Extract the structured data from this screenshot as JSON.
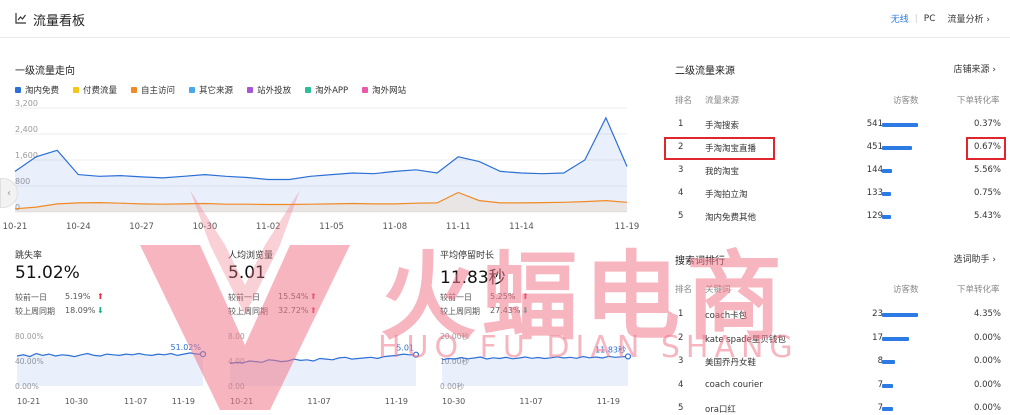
{
  "header": {
    "title": "流量看板",
    "options": [
      "无线",
      "PC",
      "流量分析"
    ],
    "active_option": "无线"
  },
  "primary_flow": {
    "title": "一级流量走向",
    "legend": [
      {
        "name": "淘内免费",
        "color": "#2c6fd6"
      },
      {
        "name": "付费流量",
        "color": "#f5c518"
      },
      {
        "name": "自主访问",
        "color": "#f08a24"
      },
      {
        "name": "其它来源",
        "color": "#4aa8e8"
      },
      {
        "name": "站外投放",
        "color": "#a855d8"
      },
      {
        "name": "淘外APP",
        "color": "#2bbf9a"
      },
      {
        "name": "淘外网站",
        "color": "#e85aa8"
      }
    ]
  },
  "chart_data": [
    {
      "type": "area",
      "y_ticks": [
        "3,200",
        "2,400",
        "1,600",
        "800",
        "0"
      ],
      "ylim": [
        0,
        3200
      ],
      "x_tick_labels": [
        "10-21",
        "10-24",
        "10-27",
        "10-30",
        "11-02",
        "11-05",
        "11-08",
        "11-11",
        "11-14",
        "11-19"
      ],
      "x": [
        "10-21",
        "10-22",
        "10-23",
        "10-24",
        "10-25",
        "10-26",
        "10-27",
        "10-28",
        "10-29",
        "10-30",
        "10-31",
        "11-01",
        "11-02",
        "11-03",
        "11-04",
        "11-05",
        "11-06",
        "11-07",
        "11-08",
        "11-09",
        "11-10",
        "11-11",
        "11-12",
        "11-13",
        "11-14",
        "11-15",
        "11-16",
        "11-17",
        "11-18",
        "11-19"
      ],
      "series": [
        {
          "name": "淘内免费",
          "color": "#2c6fd6",
          "values": [
            1250,
            1700,
            1900,
            1150,
            1100,
            1120,
            1080,
            1050,
            1100,
            1150,
            1100,
            1060,
            1000,
            1000,
            1100,
            1150,
            1200,
            1180,
            1250,
            1300,
            1200,
            1700,
            1550,
            1250,
            1200,
            1180,
            1200,
            1600,
            2900,
            1400
          ]
        },
        {
          "name": "自主访问",
          "color": "#f08a24",
          "values": [
            100,
            150,
            250,
            280,
            290,
            270,
            250,
            240,
            250,
            260,
            240,
            240,
            230,
            230,
            240,
            250,
            260,
            250,
            250,
            270,
            280,
            600,
            350,
            280,
            280,
            290,
            300,
            320,
            350,
            300
          ]
        }
      ]
    },
    {
      "type": "line",
      "name": "跳失率",
      "ylim": [
        0,
        80
      ],
      "unit": "%",
      "y_ticks": [
        "80.00%",
        "40.00%",
        "0.00%"
      ],
      "x_tick_labels": [
        "10-21",
        "10-30",
        "11-07",
        "11-19"
      ],
      "values": [
        48,
        50,
        47,
        52,
        49,
        51,
        48,
        50,
        49,
        47,
        50,
        52,
        49,
        48,
        51,
        50,
        49,
        51,
        50,
        52,
        50,
        49,
        51,
        50,
        52,
        49,
        51,
        53,
        51,
        51.02
      ],
      "last_label": "51.02%"
    },
    {
      "type": "line",
      "name": "人均浏览量",
      "ylim": [
        0,
        8
      ],
      "y_ticks": [
        "8.00",
        "4.00",
        "0.00"
      ],
      "x_tick_labels": [
        "10-21",
        "11-07",
        "11-19"
      ],
      "values": [
        3.6,
        3.8,
        3.7,
        4.0,
        3.9,
        3.8,
        4.2,
        4.1,
        3.9,
        4.0,
        4.3,
        4.1,
        4.2,
        4.0,
        4.4,
        4.3,
        4.2,
        4.5,
        4.6,
        4.3,
        4.4,
        4.5,
        4.6,
        4.4,
        4.7,
        4.8,
        4.9,
        5.1,
        5.0,
        5.01
      ],
      "last_label": "5.01"
    },
    {
      "type": "line",
      "name": "平均停留时长",
      "ylim": [
        0,
        20
      ],
      "y_ticks": [
        "20.00秒",
        "10.00秒",
        "0.00秒"
      ],
      "x_tick_labels": [
        "10-30",
        "11-07",
        "11-19"
      ],
      "values": [
        10.5,
        11,
        10.8,
        11.4,
        10.9,
        11.2,
        11.6,
        10.8,
        11.3,
        11.0,
        11.5,
        10.9,
        11.2,
        11.6,
        11.1,
        11.4,
        11.0,
        11.3,
        11.7,
        11.2,
        11.5,
        11.1,
        11.8,
        11.3,
        11.6,
        11.2,
        11.9,
        11.5,
        11.7,
        11.83
      ],
      "last_label": "11.83秒"
    }
  ],
  "metrics": [
    {
      "label": "跳失率",
      "value": "51.02%",
      "cmp1_label": "较前一日",
      "cmp1_value": "5.19%",
      "cmp1_dir": "up",
      "cmp2_label": "较上周同期",
      "cmp2_value": "18.09%",
      "cmp2_dir": "down"
    },
    {
      "label": "人均浏览量",
      "value": "5.01",
      "cmp1_label": "较前一日",
      "cmp1_value": "15.54%",
      "cmp1_dir": "up",
      "cmp2_label": "较上周同期",
      "cmp2_value": "32.72%",
      "cmp2_dir": "up"
    },
    {
      "label": "平均停留时长",
      "value": "11.83秒",
      "cmp1_label": "较前一日",
      "cmp1_value": "5.25%",
      "cmp1_dir": "up",
      "cmp2_label": "较上周同期",
      "cmp2_value": "27.43%",
      "cmp2_dir": "down"
    }
  ],
  "secondary_flow": {
    "title": "二级流量来源",
    "link": "店铺来源",
    "columns": [
      "排名",
      "流量来源",
      "访客数",
      "下单转化率"
    ],
    "rows": [
      {
        "rank": "1",
        "name": "手淘搜索",
        "visitors": "541",
        "bar": 1.0,
        "rate": "0.37%"
      },
      {
        "rank": "2",
        "name": "手淘淘宝直播",
        "visitors": "451",
        "bar": 0.83,
        "rate": "0.67%"
      },
      {
        "rank": "3",
        "name": "我的淘宝",
        "visitors": "144",
        "bar": 0.27,
        "rate": "5.56%"
      },
      {
        "rank": "4",
        "name": "手淘拍立淘",
        "visitors": "133",
        "bar": 0.25,
        "rate": "0.75%"
      },
      {
        "rank": "5",
        "name": "淘内免费其他",
        "visitors": "129",
        "bar": 0.24,
        "rate": "5.43%"
      }
    ]
  },
  "search_rank": {
    "title": "搜索词排行",
    "link": "选词助手",
    "columns": [
      "排名",
      "关键词",
      "访客数",
      "下单转化率"
    ],
    "rows": [
      {
        "rank": "1",
        "name": "coach卡包",
        "visitors": "23",
        "bar": 1.0,
        "rate": "4.35%"
      },
      {
        "rank": "2",
        "name": "kate spade星贝钱包",
        "visitors": "17",
        "bar": 0.74,
        "rate": "0.00%"
      },
      {
        "rank": "3",
        "name": "美国乔丹女鞋",
        "visitors": "8",
        "bar": 0.35,
        "rate": "0.00%"
      },
      {
        "rank": "4",
        "name": "coach courier",
        "visitors": "7",
        "bar": 0.3,
        "rate": "0.00%"
      },
      {
        "rank": "5",
        "name": "ora口红",
        "visitors": "7",
        "bar": 0.3,
        "rate": "0.00%"
      }
    ]
  },
  "watermark": {
    "text": "火蝠电商",
    "sub": "HUO FU DIAN SHANG"
  }
}
